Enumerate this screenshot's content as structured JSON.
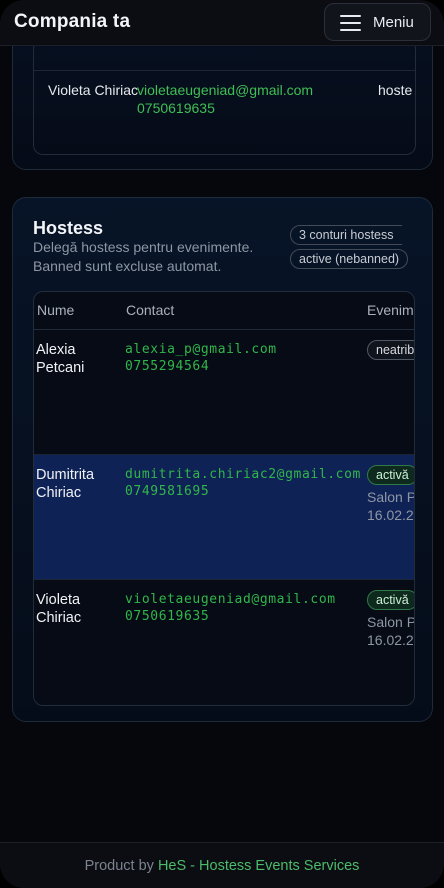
{
  "header": {
    "brand": "Compania ta",
    "menu_label": "Meniu",
    "menu_icon": "hamburger-icon"
  },
  "previous_card": {
    "row": {
      "name": "Violeta Chiriac",
      "email": "violetaeugeniad@gmail.com",
      "phone": "0750619635",
      "role": "hoste"
    }
  },
  "hostess": {
    "title": "Hostess",
    "description": "Delegă hostess pentru evenimente. Banned sunt excluse automat.",
    "count_badge": "3 conturi hostess",
    "active_badge": "active (nebanned)",
    "columns": [
      "Nume",
      "Contact",
      "Evenim"
    ],
    "rows": [
      {
        "name": "Alexia Petcani",
        "email": "alexia_p@gmail.com",
        "phone": "0755294564",
        "status": "neatrib",
        "status_kind": "neutral",
        "event": "",
        "date": ""
      },
      {
        "name": "Dumitrita Chiriac",
        "email": "dumitrita.chiriac2@gmail.com",
        "phone": "0749581695",
        "status": "activă",
        "status_kind": "active",
        "event": "Salon P",
        "date": "16.02.2",
        "selected": true
      },
      {
        "name": "Violeta Chiriac",
        "email": "violetaeugeniad@gmail.com",
        "phone": "0750619635",
        "status": "activă",
        "status_kind": "active",
        "event": "Salon P",
        "date": "16.02.2"
      }
    ]
  },
  "footer": {
    "prefix": "Product by ",
    "link": "HeS - Hostess Events Services"
  },
  "colors": {
    "accent_green": "#3fbf55",
    "selected_row": "#0f2255",
    "background": "#05070d"
  }
}
